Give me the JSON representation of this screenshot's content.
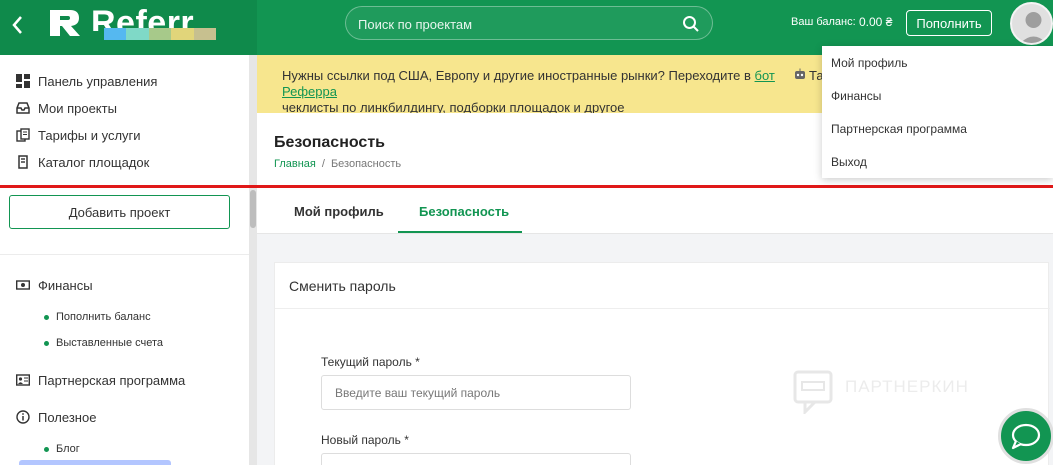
{
  "topbar": {
    "logo_text": "Referr",
    "logo_blur_colors": [
      "#55b8f0",
      "#7fd9c7",
      "#a7c98a",
      "#e1d57a",
      "#c7c08f"
    ],
    "search_placeholder": "Поиск по проектам",
    "balance_label": "Ваш баланс:",
    "balance_value": "0.00 ₴",
    "topup_label": "Пополнить"
  },
  "sidebar": {
    "nav": [
      {
        "label": "Панель управления",
        "icon": "dashboard-icon"
      },
      {
        "label": "Мои проекты",
        "icon": "inbox-icon"
      },
      {
        "label": "Тарифы и услуги",
        "icon": "documents-icon"
      },
      {
        "label": "Каталог площадок",
        "icon": "catalog-icon"
      }
    ],
    "add_project_label": "Добавить проект",
    "finance": {
      "label": "Финансы",
      "icon": "money-icon",
      "sub": [
        "Пополнить баланс",
        "Выставленные счета"
      ]
    },
    "partner": {
      "label": "Партнерская программа",
      "icon": "partner-icon"
    },
    "useful": {
      "label": "Полезное",
      "icon": "info-icon",
      "sub": [
        "Блог"
      ]
    }
  },
  "notice": {
    "text_before": "Нужны ссылки под США, Европу и другие иностранные рынки? Переходите в ",
    "link": "бот Рефeррa",
    "text_after": " Та",
    "line2": "чеклисты по линкбилдингу, подборки площадок и другое"
  },
  "page": {
    "title": "Безопасность",
    "breadcrumb": {
      "home": "Главная",
      "sep": "/",
      "current": "Безопасность"
    }
  },
  "tabs": [
    {
      "label": "Мой профиль",
      "active": false
    },
    {
      "label": "Безопасность",
      "active": true
    }
  ],
  "form": {
    "title": "Сменить пароль",
    "current_password_label": "Текущий пароль *",
    "current_password_placeholder": "Введите ваш текущий пароль",
    "new_password_label": "Новый пароль *"
  },
  "watermark": "ПАРТНЕРКИН",
  "dropdown": [
    "Мой профиль",
    "Финансы",
    "Партнерская программа",
    "Выход"
  ],
  "colors": {
    "brand": "#129552",
    "notice": "#f7e68e",
    "red_line": "#e01818"
  }
}
